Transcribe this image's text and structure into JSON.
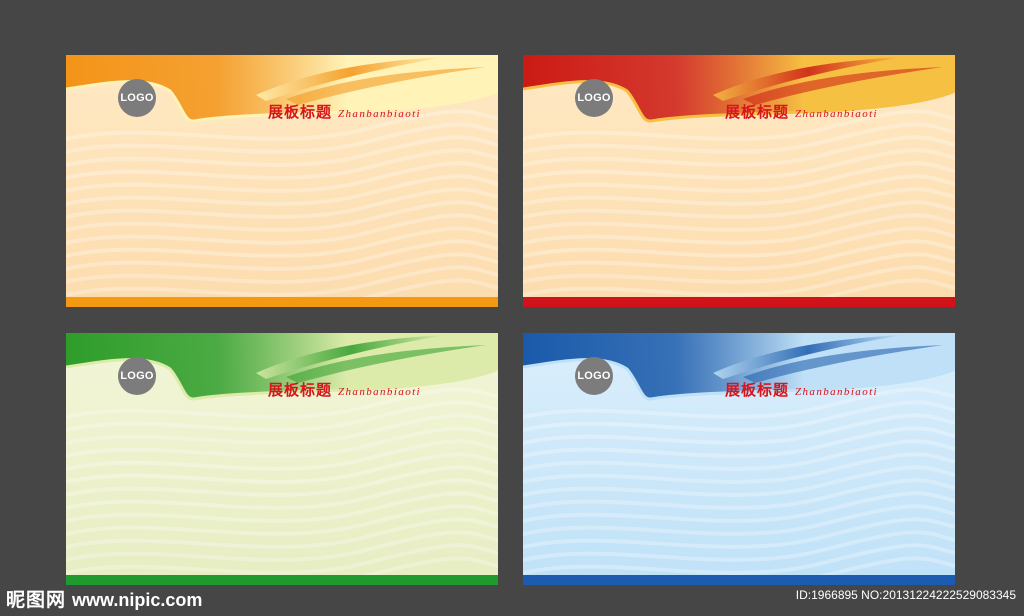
{
  "boards": [
    {
      "theme": "orange",
      "logo": "LOGO",
      "title_cn": "展板标题",
      "title_en": "Zhanbanbiaoti",
      "colors": {
        "wave_dark": "#f39418",
        "wave_light": "#fff3b8",
        "body_top": "#ffe9c4",
        "body_bottom": "#fcdcae",
        "bar": "#f39a12"
      }
    },
    {
      "theme": "red",
      "logo": "LOGO",
      "title_cn": "展板标题",
      "title_en": "Zhanbanbiaoti",
      "colors": {
        "wave_dark": "#cc1a14",
        "wave_light": "#f6c043",
        "body_top": "#ffe9c4",
        "body_bottom": "#fcdcae",
        "bar": "#d0121a"
      }
    },
    {
      "theme": "green",
      "logo": "LOGO",
      "title_cn": "展板标题",
      "title_en": "Zhanbanbiaoti",
      "colors": {
        "wave_dark": "#2e9d2a",
        "wave_light": "#dcebaa",
        "body_top": "#f3f6d8",
        "body_bottom": "#e7edc2",
        "bar": "#1f9a2f"
      }
    },
    {
      "theme": "blue",
      "logo": "LOGO",
      "title_cn": "展板标题",
      "title_en": "Zhanbanbiaoti",
      "colors": {
        "wave_dark": "#1a5aaa",
        "wave_light": "#bfe0f6",
        "body_top": "#dbeffc",
        "body_bottom": "#bfe1f7",
        "bar": "#1b5bb0"
      }
    }
  ],
  "watermark": {
    "site_cn": "昵图网",
    "site_url": "www.nipic.com",
    "id_text": "ID:1966895 NO:20131224222529083345"
  }
}
